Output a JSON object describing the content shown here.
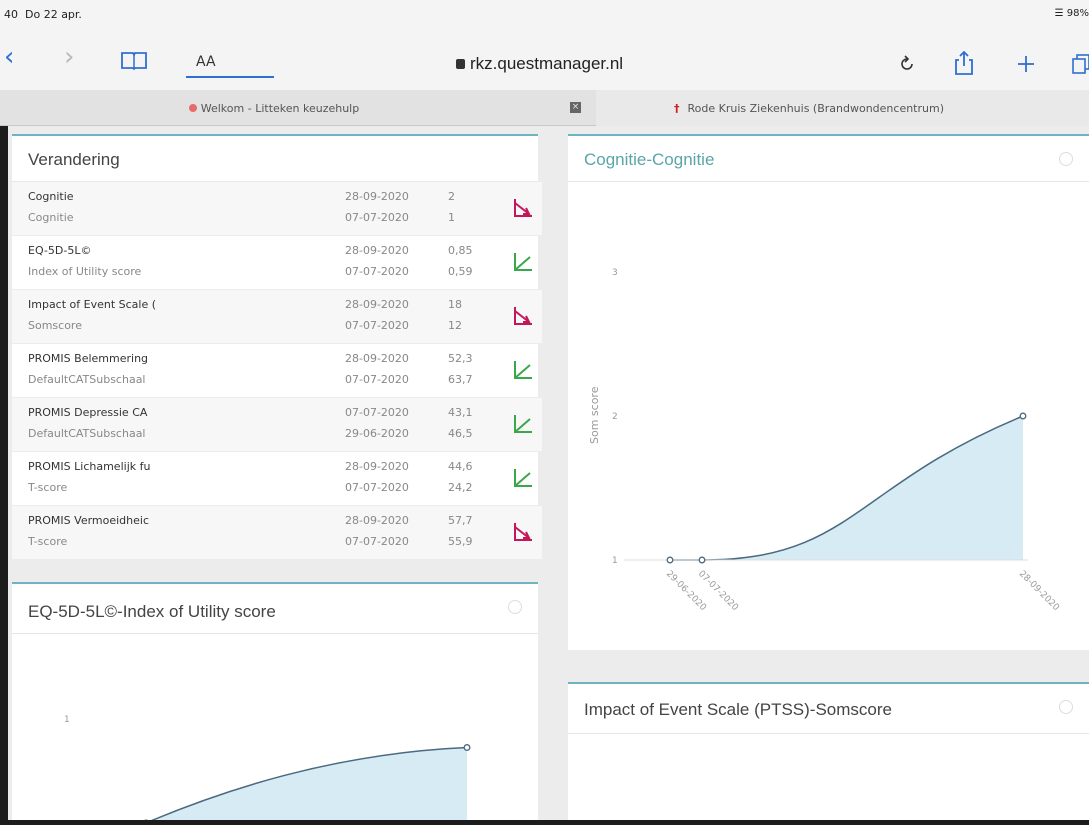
{
  "status": {
    "time": "40",
    "date": "Do 22 apr.",
    "battery": "98%"
  },
  "toolbar": {
    "text_size_label": "AA",
    "url": "rkz.questmanager.nl",
    "icons": [
      "chevron-left-icon",
      "chevron-right-icon",
      "book-icon",
      "reload-icon",
      "share-icon",
      "plus-icon",
      "tabs-icon"
    ]
  },
  "tabs": [
    {
      "label": "Welkom - Litteken keuzehulp"
    },
    {
      "label": "Rode Kruis Ziekenhuis (Brandwondencentrum)"
    }
  ],
  "verandering": {
    "title": "Verandering",
    "rows": [
      {
        "name": "Cognitie",
        "sub": "Cognitie",
        "date1": "28-09-2020",
        "date2": "07-07-2020",
        "val1": "2",
        "val2": "1",
        "trend": "down",
        "trend_icon": "trend-down-icon"
      },
      {
        "name": "EQ-5D-5L©",
        "sub": "Index of Utility score",
        "date1": "28-09-2020",
        "date2": "07-07-2020",
        "val1": "0,85",
        "val2": "0,59",
        "trend": "up",
        "trend_icon": "trend-up-icon"
      },
      {
        "name": "Impact of Event Scale (",
        "sub": "Somscore",
        "date1": "28-09-2020",
        "date2": "07-07-2020",
        "val1": "18",
        "val2": "12",
        "trend": "down",
        "trend_icon": "trend-down-icon"
      },
      {
        "name": "PROMIS Belemmering",
        "sub": "DefaultCATSubschaal",
        "date1": "28-09-2020",
        "date2": "07-07-2020",
        "val1": "52,3",
        "val2": "63,7",
        "trend": "up",
        "trend_icon": "trend-up-icon"
      },
      {
        "name": "PROMIS Depressie CA",
        "sub": "DefaultCATSubschaal",
        "date1": "07-07-2020",
        "date2": "29-06-2020",
        "val1": "43,1",
        "val2": "46,5",
        "trend": "up",
        "trend_icon": "trend-up-icon"
      },
      {
        "name": "PROMIS Lichamelijk fu",
        "sub": "T-score",
        "date1": "28-09-2020",
        "date2": "07-07-2020",
        "val1": "44,6",
        "val2": "24,2",
        "trend": "up",
        "trend_icon": "trend-up-icon"
      },
      {
        "name": "PROMIS Vermoeidheic",
        "sub": "T-score",
        "date1": "28-09-2020",
        "date2": "07-07-2020",
        "val1": "57,7",
        "val2": "55,9",
        "trend": "down",
        "trend_icon": "trend-down-icon"
      }
    ],
    "trend_colors": {
      "up": "#3aa84a",
      "down": "#c2185b"
    }
  },
  "cognitie_chart": {
    "title": "Cognitie-Cognitie",
    "ylabel": "Som score",
    "chart_data": {
      "type": "area",
      "x": [
        "29-06-2020",
        "07-07-2020",
        "28-09-2020"
      ],
      "values": [
        1,
        1,
        2
      ],
      "ylim": [
        1,
        3
      ],
      "yticks": [
        "1",
        "2",
        "3"
      ],
      "line_color": "#4a6a80",
      "fill_color": "#d6ebf3"
    }
  },
  "eq5d_chart": {
    "title": "EQ-5D-5L©-Index of Utility score",
    "chart_data": {
      "type": "area",
      "values": [
        0.59,
        0.85
      ],
      "ytick": "1",
      "line_color": "#4a6a80",
      "fill_color": "#d6ebf3"
    }
  },
  "ies_chart": {
    "title": "Impact of Event Scale (PTSS)-Somscore"
  }
}
